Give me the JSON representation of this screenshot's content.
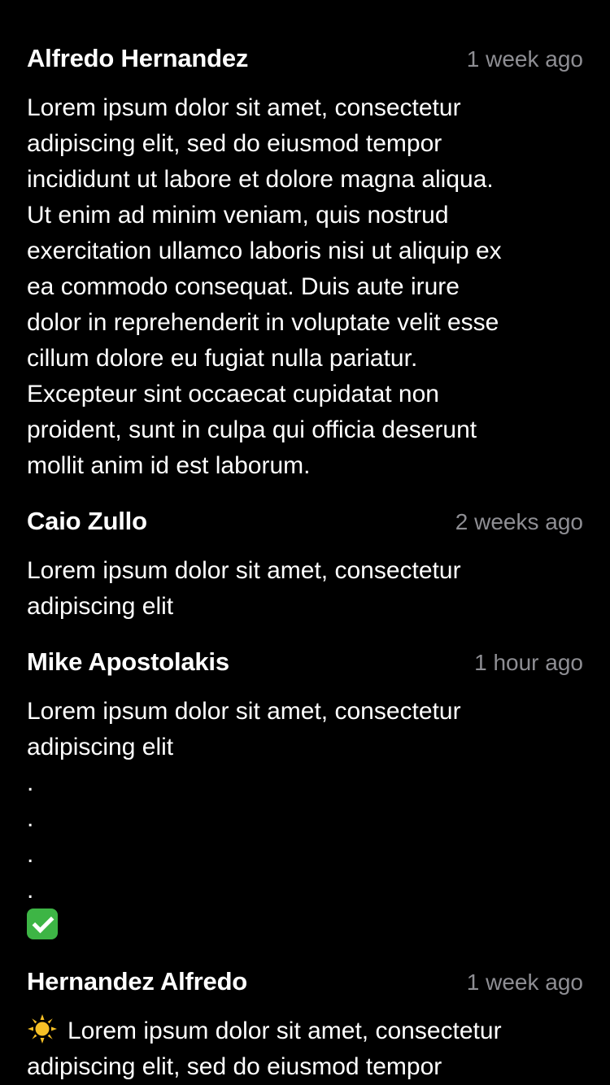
{
  "comments": [
    {
      "author": "Alfredo Hernandez",
      "time": "1 week ago",
      "body": "Lorem ipsum dolor sit amet, consectetur\nadipiscing elit, sed do eiusmod tempor\nincididunt ut labore et dolore magna aliqua.\nUt enim ad minim veniam, quis nostrud\nexercitation ullamco laboris nisi ut aliquip ex\nea commodo consequat. Duis aute irure\ndolor in reprehenderit in voluptate velit esse\ncillum dolore eu fugiat nulla pariatur.\nExcepteur sint occaecat cupidatat non\nproident, sunt in culpa qui officia deserunt\nmollit anim id est laborum."
    },
    {
      "author": "Caio Zullo",
      "time": "2 weeks ago",
      "body": "Lorem ipsum dolor sit amet, consectetur\nadipiscing elit"
    },
    {
      "author": "Mike Apostolakis",
      "time": "1 hour ago",
      "body": "Lorem ipsum dolor sit amet, consectetur\nadipiscing elit\n.\n.\n.\n.",
      "trailing_emoji": "check-mark-emoji"
    },
    {
      "author": "Hernandez Alfredo",
      "time": "1 week ago",
      "leading_emoji": "sun-emoji",
      "body": "Lorem ipsum dolor sit amet, consectetur\nadipiscing elit, sed do eiusmod tempor"
    }
  ],
  "colors": {
    "background": "#000000",
    "text": "#ffffff",
    "timestamp": "#8e8e93",
    "check_emoji": "#3db545",
    "sun_emoji": "#f6c026"
  }
}
